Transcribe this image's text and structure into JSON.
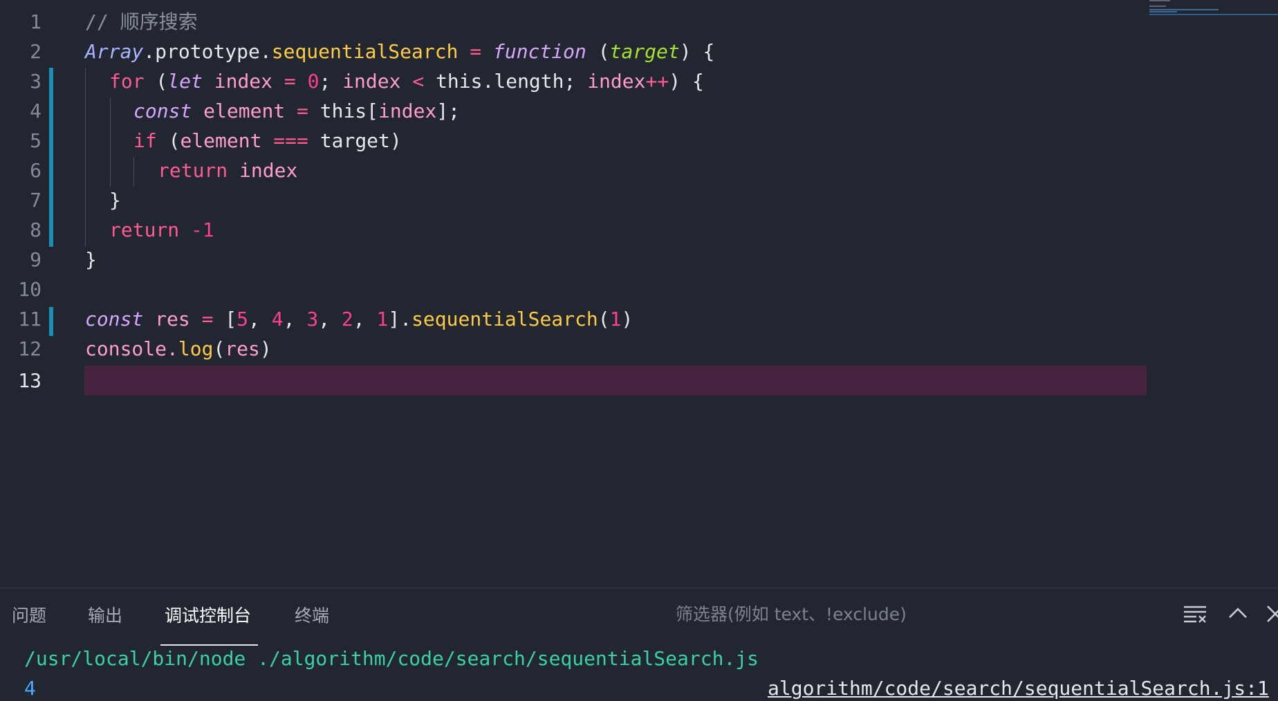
{
  "editor": {
    "line_numbers": [
      "1",
      "2",
      "3",
      "4",
      "5",
      "6",
      "7",
      "8",
      "9",
      "10",
      "11",
      "12",
      "13"
    ],
    "lines": {
      "l1": {
        "comment": "// 顺序搜索"
      },
      "l2": {
        "cls": "Array",
        "dot1": ".prototype.",
        "fn": "sequentialSearch",
        "eq": " = ",
        "kw": "function",
        "paren_open": " (",
        "param": "target",
        "paren_close": ") {"
      },
      "l3": {
        "kw_for": "for",
        "p1": " (",
        "kw_let": "let",
        "v1": " index",
        "op1": " = ",
        "n0": "0",
        "p2": "; ",
        "v2": "index",
        "op2": " < ",
        "p3": "this.length; ",
        "v3": "index",
        "op3": "++",
        "p4": ") {"
      },
      "l4": {
        "kw_const": "const",
        "v1": " element",
        "op1": " = ",
        "p1": "this[",
        "v2": "index",
        "p2": "];"
      },
      "l5": {
        "kw_if": "if",
        "p1": " (",
        "v1": "element",
        "op1": " === ",
        "p2": "target)"
      },
      "l6": {
        "kw_return": "return",
        "v1": " index"
      },
      "l7": {
        "brace": "}"
      },
      "l8": {
        "kw_return": "return",
        "num": " -1"
      },
      "l9": {
        "brace": "}"
      },
      "l10": {},
      "l11": {
        "kw_const": "const",
        "v1": " res",
        "op1": " = ",
        "b1": "[",
        "n5": "5",
        "c1": ", ",
        "n4": "4",
        "c2": ", ",
        "n3": "3",
        "c3": ", ",
        "n2": "2",
        "c4": ", ",
        "n1": "1",
        "b2": "].",
        "fn": "sequentialSearch",
        "p1": "(",
        "arg": "1",
        "p2": ")"
      },
      "l12": {
        "obj": "console.",
        "fn": "log",
        "p1": "(",
        "v1": "res",
        "p2": ")"
      },
      "l13": {}
    }
  },
  "panel": {
    "tabs": [
      {
        "label": "问题"
      },
      {
        "label": "输出"
      },
      {
        "label": "调试控制台"
      },
      {
        "label": "终端"
      }
    ],
    "active_tab": "调试控制台",
    "filter_placeholder": "筛选器(例如 text、!exclude)",
    "console": {
      "command": "/usr/local/bin/node ./algorithm/code/search/sequentialSearch.js",
      "output": "4",
      "source_link": "algorithm/code/search/sequentialSearch.js:1"
    },
    "icons": [
      "clear-console-icon",
      "chevron-up-icon",
      "close-icon"
    ]
  },
  "colors": {
    "background": "#222631",
    "current_line": "#472340",
    "git_modified": "#1a8fb4",
    "keyword": "#ff5b8f",
    "function": "#ffcb47",
    "parameter": "#a6e22e",
    "console_command": "#3ad1a4",
    "console_output": "#4aa8ff"
  }
}
